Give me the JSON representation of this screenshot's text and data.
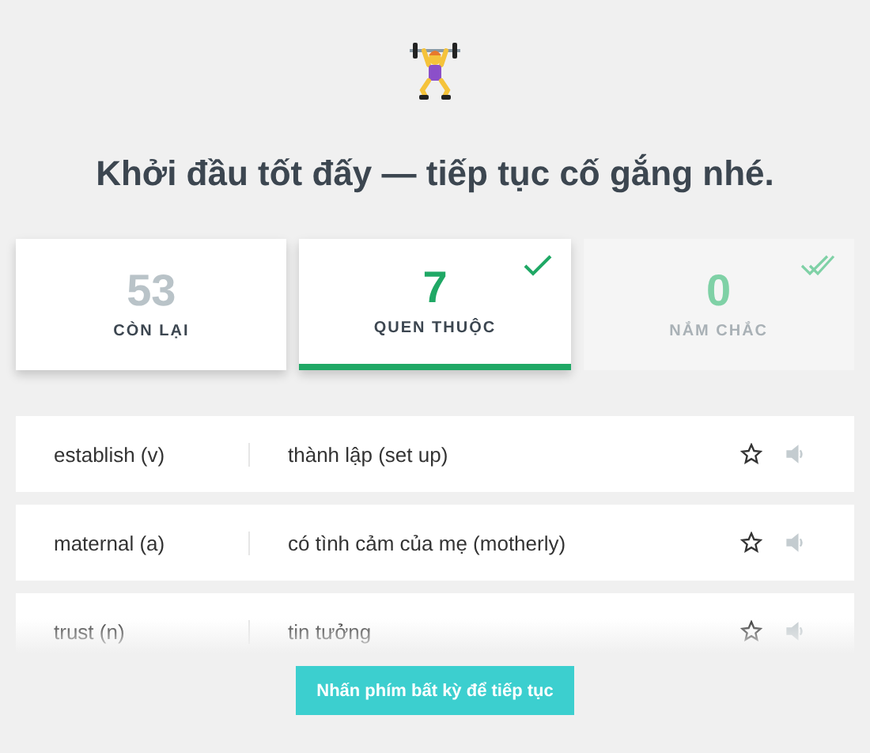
{
  "heading": "Khởi đầu tốt đấy — tiếp tục cố gắng nhé.",
  "stats": [
    {
      "kind": "remaining",
      "count": "53",
      "label": "CÒN LẠI",
      "selected": false,
      "disabled": false
    },
    {
      "kind": "familiar",
      "count": "7",
      "label": "QUEN THUỘC",
      "selected": true,
      "disabled": false
    },
    {
      "kind": "mastered",
      "count": "0",
      "label": "NẮM CHẮC",
      "selected": false,
      "disabled": true
    }
  ],
  "words": [
    {
      "term": "establish (v)",
      "meaning": "thành lập (set up)",
      "starred": false
    },
    {
      "term": "maternal (a)",
      "meaning": "có tình cảm của mẹ (motherly)",
      "starred": false
    },
    {
      "term": "trust (n)",
      "meaning": "tin tưởng",
      "starred": false
    }
  ],
  "continue_button": "Nhấn phím bất kỳ để tiếp tục"
}
